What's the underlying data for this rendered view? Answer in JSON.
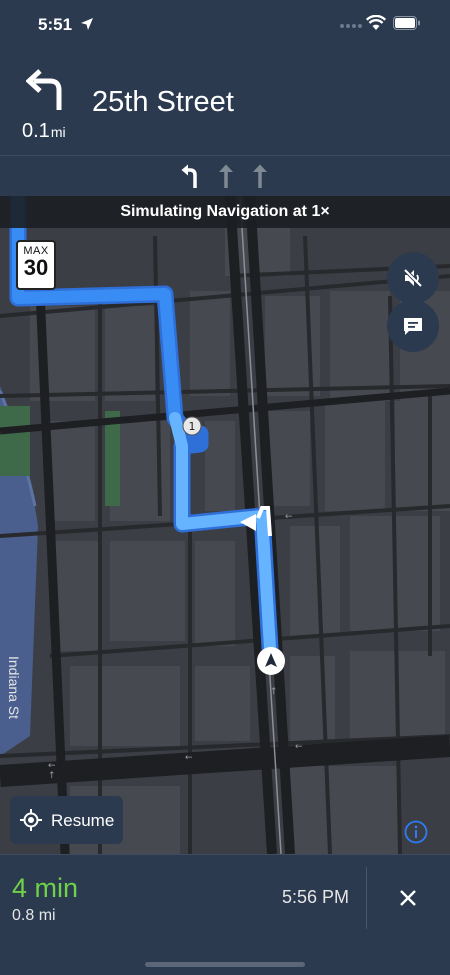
{
  "status_bar": {
    "time": "5:51"
  },
  "instruction": {
    "distance_value": "0.1",
    "distance_unit": "mi",
    "street": "25th Street"
  },
  "lanes": [
    "left",
    "straight",
    "straight"
  ],
  "map": {
    "simulation_banner": "Simulating Navigation at 1×",
    "speed_limit": {
      "label": "MAX",
      "value": "30"
    },
    "street_label": "Indiana St",
    "route_marker": "1",
    "resume_label": "Resume"
  },
  "trip": {
    "eta_duration": "4 min",
    "remaining_distance": "0.8 mi",
    "arrival_time": "5:56 PM"
  },
  "colors": {
    "panel": "#2b3a4f",
    "route": "#4a9eff",
    "eta_green": "#6ed14a",
    "map_ground": "#3b3e45",
    "info_blue": "#2f7bf5"
  }
}
